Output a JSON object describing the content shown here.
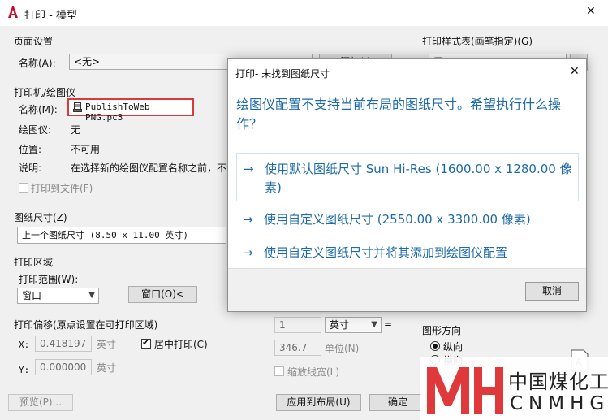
{
  "window": {
    "title": "打印 - 模型",
    "close_glyph": "✕"
  },
  "page_setup": {
    "group_label": "页面设置",
    "name_label": "名称(A):",
    "name_value": "<无>",
    "add_button": "添加(.)"
  },
  "printer": {
    "group_label": "打印机/绘图仪",
    "name_label": "名称(M):",
    "name_value": "PublishToWeb PNG.pc3",
    "plotter_label": "绘图仪:",
    "plotter_value": "无",
    "location_label": "位置:",
    "location_value": "不可用",
    "desc_label": "说明:",
    "desc_value": "在选择新的绘图仪配置名称之前，不",
    "print_to_file": "打印到文件(F)"
  },
  "paper_size": {
    "group_label": "图纸尺寸(Z)",
    "value": "上一个图纸尺寸 (8.50 x 11.00 英寸)"
  },
  "plot_area": {
    "group_label": "打印区域",
    "range_label": "打印范围(W):",
    "range_value": "窗口",
    "window_button": "窗口(O)<"
  },
  "plot_offset": {
    "group_label": "打印偏移(原点设置在可打印区域)",
    "x_label": "X:",
    "x_value": "0.418197",
    "x_unit": "英寸",
    "y_label": "Y:",
    "y_value": "0.000000",
    "y_unit": "英寸",
    "center_label": "居中打印(C)",
    "center_checked": true
  },
  "scale": {
    "value1": "1",
    "unit_value": "英寸",
    "equals": "=",
    "value2": "346.7",
    "unit_label": "单位(N)",
    "scale_lineweights": "缩放线宽(L)"
  },
  "plot_style": {
    "group_label": "打印样式表(画笔指定)(G)",
    "value": "无"
  },
  "orientation": {
    "group_label": "图形方向",
    "portrait": "纵向",
    "landscape": "横向",
    "selected": "纵向"
  },
  "bottom_buttons": {
    "preview": "预览(P)...",
    "apply": "应用到布局(U)",
    "ok": "确定"
  },
  "dialog": {
    "title": "打印- 未找到图纸尺寸",
    "close_glyph": "✕",
    "question": "绘图仪配置不支持当前布局的图纸尺寸。希望执行什么操作？",
    "arrow_glyph": "→",
    "options": [
      "使用默认图纸尺寸 Sun Hi-Res (1600.00 x 1280.00 像素)",
      "使用自定义图纸尺寸 (2550.00 x 3300.00 像素)",
      "使用自定义图纸尺寸并将其添加到绘图仪配置"
    ],
    "cancel": "取消"
  },
  "watermark": {
    "logo": "MH",
    "cn": "中国煤化工",
    "en": "CNMHG"
  },
  "colors": {
    "accent_blue": "#1e6aa8",
    "highlight_red": "#d93a3a",
    "logo_red": "#e0393b",
    "app_icon_red": "#c8102e"
  }
}
